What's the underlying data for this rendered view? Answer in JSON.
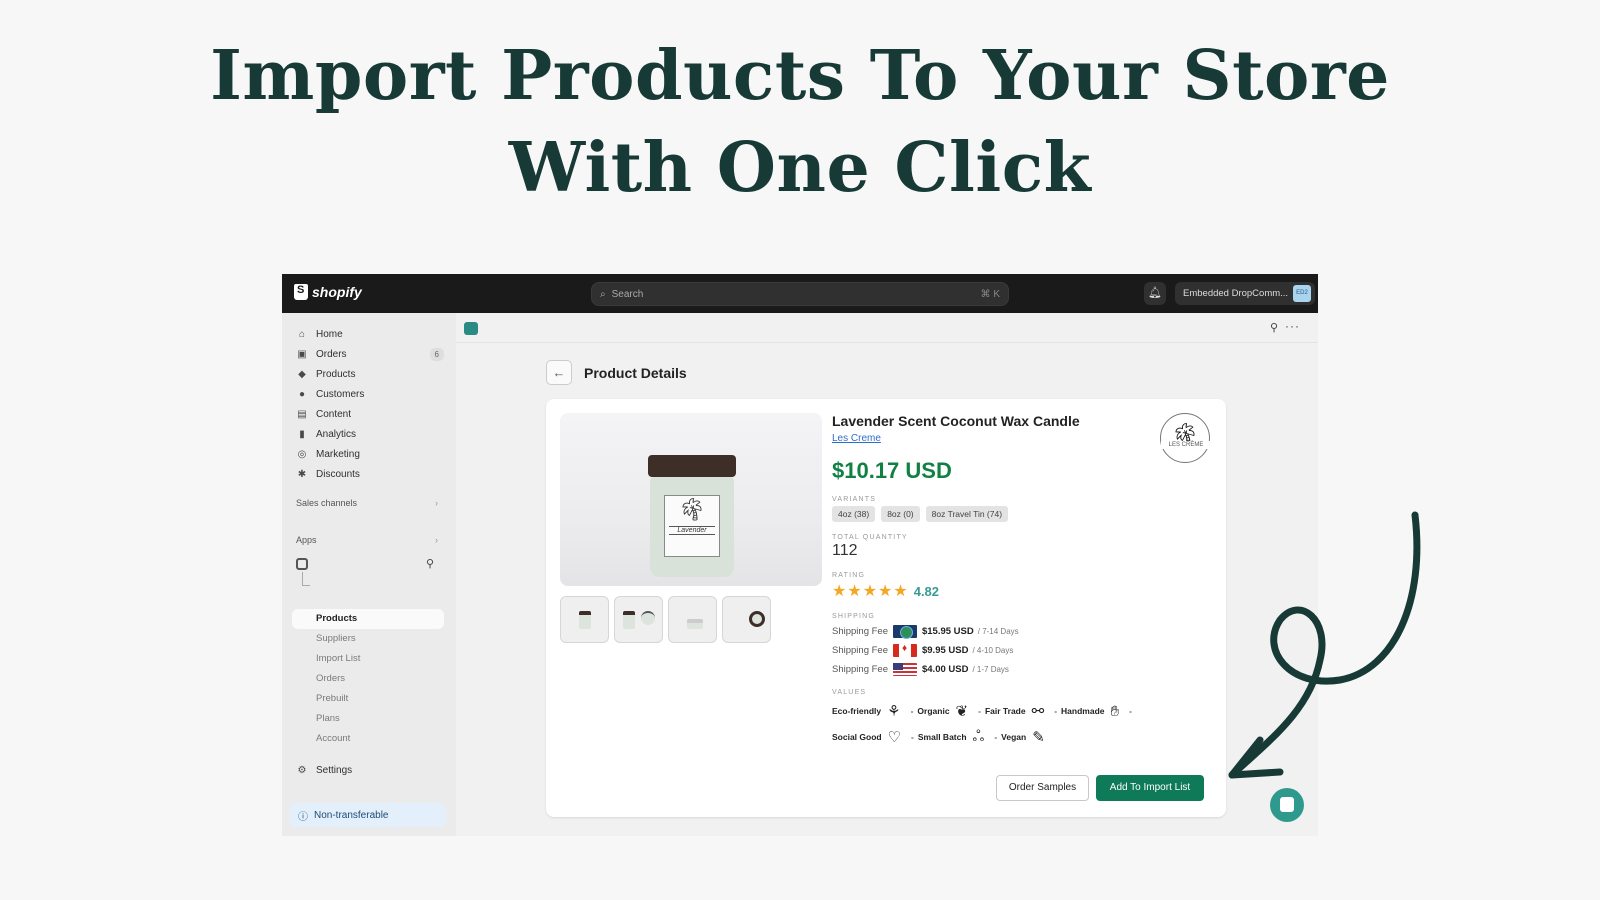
{
  "headline": {
    "line1": "Import Products To Your Store",
    "line2": "With One Click"
  },
  "topbar": {
    "brand": "shopify",
    "search_placeholder": "Search",
    "search_shortcut": "⌘ K",
    "store_name": "Embedded DropComm...",
    "store_avatar": "ED2"
  },
  "sidebar": {
    "items": [
      {
        "label": "Home",
        "icon": "⌂"
      },
      {
        "label": "Orders",
        "icon": "▣",
        "badge": "6"
      },
      {
        "label": "Products",
        "icon": "◆"
      },
      {
        "label": "Customers",
        "icon": "●"
      },
      {
        "label": "Content",
        "icon": "▤"
      },
      {
        "label": "Analytics",
        "icon": "▮"
      },
      {
        "label": "Marketing",
        "icon": "◎"
      },
      {
        "label": "Discounts",
        "icon": "✱"
      }
    ],
    "sales_channels": "Sales channels",
    "apps": "Apps",
    "app_subitems": [
      "Products",
      "Suppliers",
      "Import List",
      "Orders",
      "Prebuilt",
      "Plans",
      "Account"
    ],
    "settings": "Settings",
    "non_transferable": "Non-transferable"
  },
  "page": {
    "title": "Product Details"
  },
  "product": {
    "name": "Lavender Scent Coconut Wax Candle",
    "vendor": "Les Creme",
    "brand_logo_text": "LES CRÈME",
    "jar_label": "Lavender",
    "price": "$10.17 USD",
    "variants_label": "VARIANTS",
    "variants": [
      "4oz (38)",
      "8oz (0)",
      "8oz Travel Tin (74)"
    ],
    "total_quantity_label": "TOTAL QUANTITY",
    "total_quantity": "112",
    "rating_label": "RATING",
    "rating": "4.82",
    "rating_stars": 5,
    "shipping_label": "SHIPPING",
    "shipping": [
      {
        "label": "Shipping Fee",
        "region": "worldwide",
        "price": "$15.95 USD",
        "days": "/ 7-14 Days"
      },
      {
        "label": "Shipping Fee",
        "region": "canada",
        "price": "$9.95 USD",
        "days": "/ 4-10 Days"
      },
      {
        "label": "Shipping Fee",
        "region": "usa",
        "price": "$4.00 USD",
        "days": "/ 1-7 Days"
      }
    ],
    "values_label": "VALUES",
    "values": [
      {
        "label": "Eco-friendly",
        "icon": "🌳"
      },
      {
        "label": "Organic",
        "icon": "🍃"
      },
      {
        "label": "Fair Trade",
        "icon": "🤝"
      },
      {
        "label": "Handmade",
        "icon": "✋"
      },
      {
        "label": "Social Good",
        "icon": "♡"
      },
      {
        "label": "Small Batch",
        "icon": "⁂"
      },
      {
        "label": "Vegan",
        "icon": "🥕"
      }
    ]
  },
  "actions": {
    "order_samples": "Order Samples",
    "add_to_import": "Add To Import List"
  },
  "colors": {
    "accent": "#0e7a57",
    "headline": "#173a36",
    "price": "#108043",
    "rating": "#3a9a94"
  }
}
